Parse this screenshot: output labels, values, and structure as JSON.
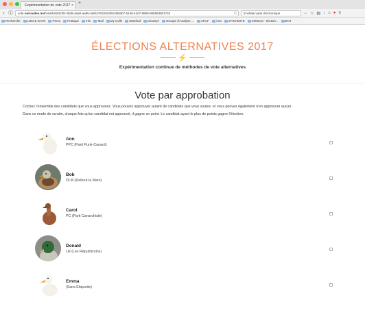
{
  "browser": {
    "tab_title": "Expérimentation de vote 2017",
    "tab_close": "×",
    "new_tab": "+",
    "url_prefix": "vote.",
    "url_host": "noirsudes.net",
    "url_path": "/vote/bmb3cfdr-2bd9-4ea9-aa85-3e8137619153/0cdb8d07-6149-42d7-9980-96b96380172d",
    "reload": "C",
    "search_value": "whale voter électronique",
    "bookmarks": [
      "Recherche",
      "UJM & GATE",
      "Perso",
      "Pratique",
      "Info",
      "Mail",
      "My Colle",
      "Stanford",
      "DicoSyn",
      "Groupe d'Analyse ...",
      "ATILF",
      "i-arc",
      "DYNAMITE",
      "CRISCO - Diction...",
      "ENT"
    ]
  },
  "header": {
    "title": "ÉLECTIONS ALTERNATIVES 2017",
    "bolt": "⚡",
    "subtitle": "Expérimentation continue de méthodes de vote alternatives"
  },
  "main": {
    "title": "Vote par approbation",
    "intro": "Cochez l'ensemble des candidats que vous approuvez. Vous pouvez approuver autant de candidats que vous voulez, et vous pouvez également n'en approuver aucun.",
    "rule": "Dans ce mode de scrutin, chaque fois qu'un candidat est approuvé, il gagne un point. Le candidat ayant le plus de points gagne l'élection."
  },
  "candidates": [
    {
      "name": "Ann",
      "party": "PPC (Parti Punk-Canard)",
      "checked": false,
      "avatar": "duck-ann-icon"
    },
    {
      "name": "Bob",
      "party": "DLM (Debout la Mare)",
      "checked": false,
      "avatar": "duck-bob-icon"
    },
    {
      "name": "Carol",
      "party": "PC (Parti Canarchiste)",
      "checked": false,
      "avatar": "duck-carol-icon"
    },
    {
      "name": "Donald",
      "party": "LR (Les Républicoins)",
      "checked": false,
      "avatar": "duck-donald-icon"
    },
    {
      "name": "Emma",
      "party": "(Sans Étiquette)",
      "checked": false,
      "avatar": "duck-emma-icon"
    }
  ],
  "colors": {
    "accent": "#f0824e",
    "text": "#333333"
  }
}
